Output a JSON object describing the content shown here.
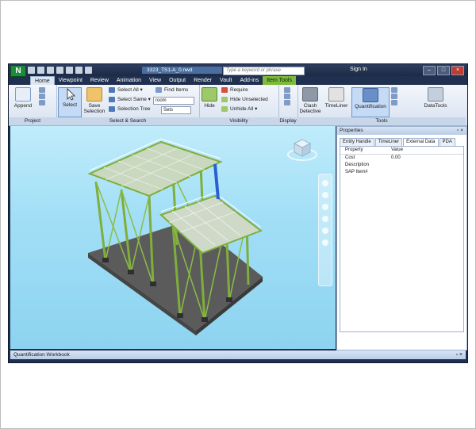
{
  "window": {
    "filename": "3323_TS1-A_0.nwd",
    "search_placeholder": "Type a keyword or phrase",
    "sign_in": "Sign In"
  },
  "tabs": [
    "Home",
    "Viewpoint",
    "Review",
    "Animation",
    "View",
    "Output",
    "Render",
    "Vault",
    "Add-ins",
    "Item Tools"
  ],
  "active_tab": "Home",
  "ribbon": {
    "project": {
      "label": "Project",
      "append": "Append"
    },
    "select_search": {
      "label": "Select & Search",
      "select": "Select",
      "save_selection": "Save Selection",
      "select_all": "Select All",
      "select_same": "Select Same",
      "selection_tree": "Selection Tree",
      "find_items": "Find Items",
      "find_value": "room",
      "sets": "Sets"
    },
    "visibility": {
      "label": "Visibility",
      "hide": "Hide",
      "require": "Require",
      "hide_unselected": "Hide Unselected",
      "unhide_all": "Unhide All"
    },
    "display": {
      "label": "Display"
    },
    "tools": {
      "label": "Tools",
      "clash": "Clash Detective",
      "timeliner": "TimeLiner",
      "quantification": "Quantification",
      "datatools": "DataTools"
    }
  },
  "properties": {
    "title": "Properties",
    "tabs": [
      "Entity Handle",
      "TimeLiner",
      "External Data",
      "PDA"
    ],
    "active_tab": "External Data",
    "columns": [
      "Property",
      "Value"
    ],
    "rows": [
      {
        "property": "Cost",
        "value": "0.00"
      },
      {
        "property": "Description",
        "value": ""
      },
      {
        "property": "SAP Item#",
        "value": ""
      }
    ]
  },
  "bottom_panel": {
    "title": "Quantification Workbook"
  },
  "colors": {
    "steel_green": "#7fae3a",
    "slab_gray": "#5d5d5d",
    "sky": "#a6e0f7",
    "ribbon_bg": "#dfe8f4"
  }
}
